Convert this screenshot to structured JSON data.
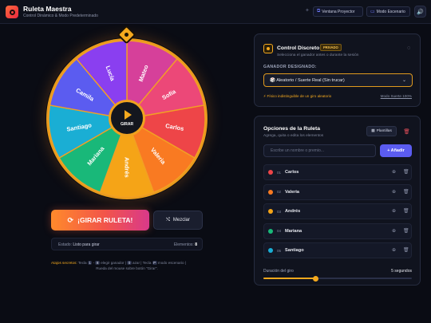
{
  "header": {
    "title": "Ruleta Maestra",
    "subtitle": "Control Dinámico & Modo Predeterminado",
    "projector_button": "Ventana Proyector",
    "scenario_button": "Modo Escenario",
    "projector_icon": "external-window-icon",
    "scenario_icon": "monitor-icon",
    "sound_icon": "speaker-icon"
  },
  "wheel": {
    "center_label": "GIRAR",
    "segments": [
      {
        "label": "Mateo",
        "color": "#d6409a"
      },
      {
        "label": "Sofía",
        "color": "#ec4878"
      },
      {
        "label": "Carlos",
        "color": "#ee4548"
      },
      {
        "label": "Valeria",
        "color": "#f97a22"
      },
      {
        "label": "Andrés",
        "color": "#f5a417"
      },
      {
        "label": "Mariana",
        "color": "#19b879"
      },
      {
        "label": "Santiago",
        "color": "#1aaed4"
      },
      {
        "label": "Camila",
        "color": "#5b5cf0"
      },
      {
        "label": "Lucía",
        "color": "#8a3ff0"
      }
    ]
  },
  "actions": {
    "spin_button": "¡GIRAR RULETA!",
    "shuffle_button": "Mezclar",
    "spin_icon": "refresh-icon",
    "shuffle_icon": "shuffle-icon"
  },
  "status": {
    "label": "Estado:",
    "value": "Listo para girar",
    "elements_label": "Elementos:",
    "elements_value": "8"
  },
  "secret_hint": {
    "lead": "Atajos secretos:",
    "part1": "Tecla",
    "key1": "1",
    "dash": "-",
    "key2": "8",
    "part2": "elegir ganador |",
    "key3": "0",
    "part3": "azar | Tecla",
    "key4": "P",
    "part4": "modo escenario |",
    "line2": "Rueda del mouse sobre botón \"Girar\"."
  },
  "control": {
    "title": "Control Discreto",
    "badge": "PRIVADO",
    "subtitle": "Selecciona el ganador antes o durante la sesión",
    "winner_label": "GANADOR DESIGNADO:",
    "winner_value": "🎲 Aleatorio / Suerte Real (Sin trucar)",
    "note": "⚡ Físico indistinguible de un giro aleatorio",
    "mode_link": "Modo Suerte 100%",
    "icon": "target-icon",
    "eye_icon": "eye-off-icon"
  },
  "options": {
    "title": "Opciones de la Ruleta",
    "subtitle": "Agrega, quita o edita los elementos",
    "templates_button": "Plantillas",
    "templates_icon": "grid-icon",
    "clear_icon": "trash-icon",
    "input_placeholder": "Escribe un nombre o premio...",
    "add_button": "+ Añadir",
    "items": [
      {
        "num": "01",
        "name": "Carlos",
        "color": "#ee4548"
      },
      {
        "num": "02",
        "name": "Valeria",
        "color": "#f97a22"
      },
      {
        "num": "03",
        "name": "Andrés",
        "color": "#f5a417"
      },
      {
        "num": "04",
        "name": "Mariana",
        "color": "#19b879"
      },
      {
        "num": "05",
        "name": "Santiago",
        "color": "#1aaed4"
      }
    ],
    "duration_label": "Duración del giro",
    "duration_value": "5 segundos",
    "duration_fraction": 0.35
  }
}
